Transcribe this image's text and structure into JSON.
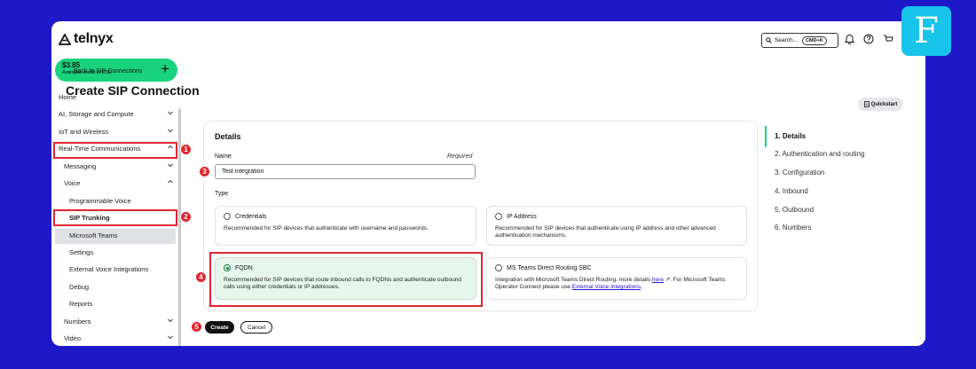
{
  "app": {
    "logo_text": "telnyx"
  },
  "topbar": {
    "search_text": "Search...",
    "search_shortcut": "CMD+K",
    "icons": [
      "search-icon",
      "bell-icon",
      "help-icon",
      "cart-icon"
    ]
  },
  "sidebar": {
    "credit_amount": "$3.85",
    "credit_sub": "Available credit in USD",
    "credit_add": "+",
    "items": [
      {
        "label": "Home"
      },
      {
        "label": "AI, Storage and Compute"
      },
      {
        "label": "IoT and Wireless"
      },
      {
        "label": "Real-Time Communications"
      },
      {
        "label": "Messaging"
      },
      {
        "label": "Voice"
      },
      {
        "label": "Programmable Voice"
      },
      {
        "label": "SIP Trunking"
      },
      {
        "label": "Microsoft Teams"
      },
      {
        "label": "Settings"
      },
      {
        "label": "External Voice Integrations"
      },
      {
        "label": "Debug"
      },
      {
        "label": "Reports"
      },
      {
        "label": "Numbers"
      },
      {
        "label": "Video"
      }
    ]
  },
  "page": {
    "back_link": "← Back to SIP Connections",
    "title": "Create SIP Connection",
    "quickstart": "Quickstart"
  },
  "form": {
    "section_title": "Details",
    "name_label": "Name",
    "required_label": "Required",
    "name_value": "Test integration",
    "type_label": "Type",
    "options": [
      {
        "label": "Credentials",
        "desc": "Recommended for SIP devices that authenticate with username and passwords."
      },
      {
        "label": "IP Address",
        "desc": "Recommended for SIP devices that authenticate using IP address and other advanced authentication mechanisms."
      },
      {
        "label": "FQDN",
        "desc": "Recommended for SIP devices that route inbound calls to FQDNs and authenticate outbound calls using either credentials or IP addresses."
      },
      {
        "label": "MS Teams Direct Routing SBC",
        "desc_pre": "Integration with Microsoft Teams Direct Routing, more details ",
        "desc_link1": "here",
        "desc_link1_arrow": "↗",
        "desc_mid": ". For Microsoft Teams Operator Connect please use ",
        "desc_link2": "External Voice Integrations",
        "desc_post": "."
      }
    ],
    "selected": "FQDN",
    "create_button": "Create",
    "cancel_button": "Cancel"
  },
  "steps": [
    "1. Details",
    "2. Authentication and routing",
    "3. Configuration",
    "4. Inbound",
    "5. Outbound",
    "6. Numbers"
  ],
  "markers": [
    "1",
    "2",
    "3",
    "4",
    "5"
  ],
  "badge": {
    "letter": "F"
  },
  "colors": {
    "background": "#1d18c8",
    "accent": "#19d37c",
    "annotation": "#e0262f",
    "selected_option": "#e6f6ec",
    "badge": "#18c4ea"
  }
}
